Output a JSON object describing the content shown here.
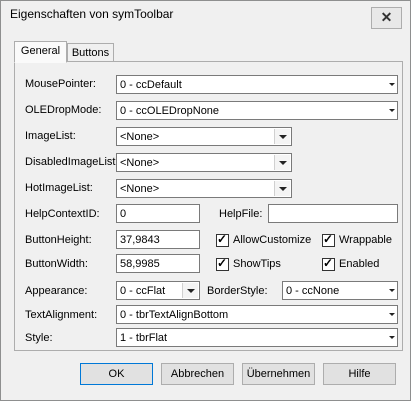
{
  "window": {
    "title": "Eigenschaften von symToolbar",
    "close": "✕"
  },
  "tabs": [
    {
      "label": "General"
    },
    {
      "label": "Buttons"
    }
  ],
  "fields": {
    "mouse_pointer": {
      "label": "MousePointer:",
      "value": "0 - ccDefault"
    },
    "ole_drop_mode": {
      "label": "OLEDropMode:",
      "value": "0 - ccOLEDropNone"
    },
    "image_list": {
      "label": "ImageList:",
      "value": "<None>"
    },
    "disabled_image_list": {
      "label": "DisabledImageList:",
      "value": "<None>"
    },
    "hot_image_list": {
      "label": "HotImageList:",
      "value": "<None>"
    },
    "help_context_id": {
      "label": "HelpContextID:",
      "value": "0"
    },
    "help_file": {
      "label": "HelpFile:",
      "value": ""
    },
    "button_height": {
      "label": "ButtonHeight:",
      "value": "37,9843"
    },
    "button_width": {
      "label": "ButtonWidth:",
      "value": "58,9985"
    },
    "appearance": {
      "label": "Appearance:",
      "value": "0 - ccFlat"
    },
    "border_style": {
      "label": "BorderStyle:",
      "value": "0 - ccNone"
    },
    "text_alignment": {
      "label": "TextAlignment:",
      "value": "0 - tbrTextAlignBottom"
    },
    "style": {
      "label": "Style:",
      "value": "1 - tbrFlat"
    }
  },
  "checkboxes": {
    "allow_customize": {
      "label": "AllowCustomize",
      "checked": true
    },
    "wrappable": {
      "label": "Wrappable",
      "checked": true
    },
    "show_tips": {
      "label": "ShowTips",
      "checked": true
    },
    "enabled": {
      "label": "Enabled",
      "checked": true
    }
  },
  "buttons": {
    "ok": "OK",
    "cancel": "Abbrechen",
    "apply": "Übernehmen",
    "help": "Hilfe"
  },
  "colors": {
    "window_bg": "#f0f0f0",
    "ok_border": "#0078d7"
  }
}
